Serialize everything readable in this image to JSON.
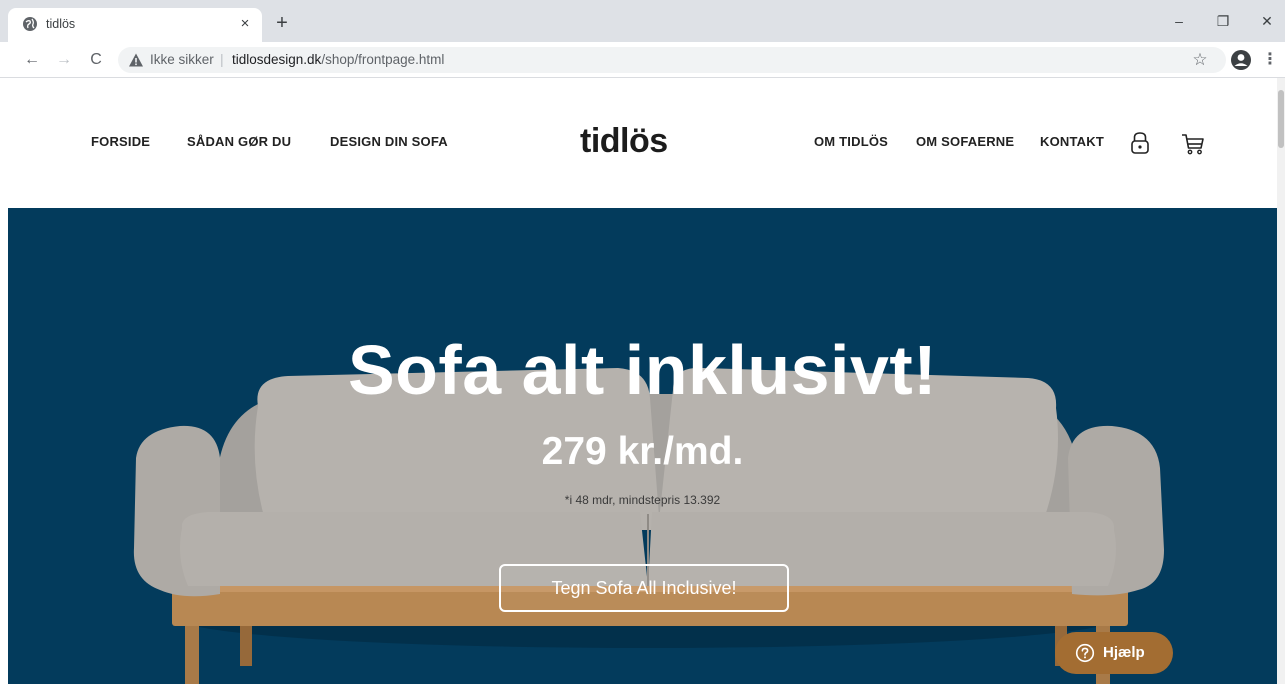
{
  "browser": {
    "tab_title": "tidlös",
    "tab_close": "×",
    "new_tab": "+",
    "window_controls": {
      "minimize": "–",
      "restore": "❐",
      "close": "✕"
    },
    "nav": {
      "back": "←",
      "forward": "→",
      "reload": "C"
    },
    "security_label": "Ikke sikker",
    "url_separator": "|",
    "url_host": "tidlosdesign.dk",
    "url_path": "/shop/frontpage.html",
    "bookmark_star": "☆",
    "menu": "⋮",
    "icons": [
      "globe-icon",
      "warning-icon",
      "star-icon",
      "profile-icon",
      "kebab-menu-icon"
    ]
  },
  "header": {
    "nav_left": [
      "FORSIDE",
      "SÅDAN GØR DU",
      "DESIGN DIN SOFA"
    ],
    "logo": "tidlös",
    "nav_right": [
      "OM TIDLÖS",
      "OM SOFAERNE",
      "KONTAKT"
    ],
    "icons": [
      "lock-icon",
      "cart-icon"
    ]
  },
  "hero": {
    "title": "Sofa alt inklusivt!",
    "price": "279 kr./md.",
    "note": "*i 48 mdr, mindstepris 13.392",
    "cta_label": "Tegn Sofa All Inclusive!",
    "background_color": "#033b5c"
  },
  "help": {
    "label": "Hjælp",
    "color": "#a36d32"
  }
}
